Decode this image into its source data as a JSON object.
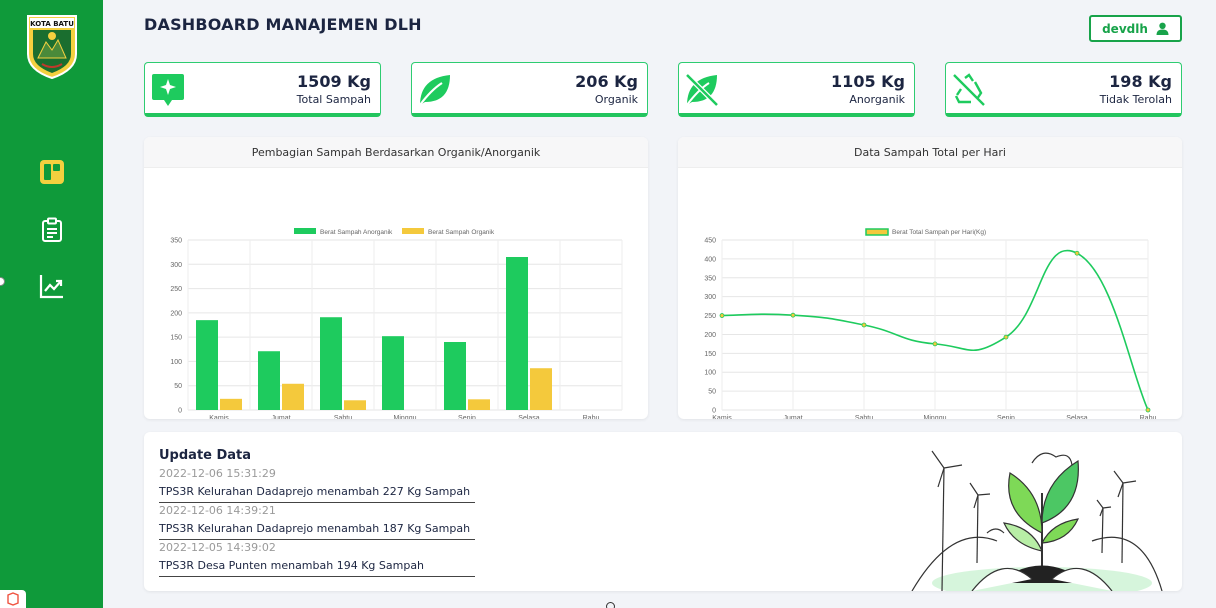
{
  "sidebar": {
    "logo_text": "KOTA BATU",
    "items": [
      {
        "icon": "dashboard-icon"
      },
      {
        "icon": "clipboard-icon"
      },
      {
        "icon": "chart-icon"
      }
    ]
  },
  "header": {
    "title": "DASHBOARD MANAJEMEN DLH",
    "user": "devdlh"
  },
  "stats": [
    {
      "value": "1509 Kg",
      "label": "Total Sampah",
      "icon": "sparkle-pin-icon"
    },
    {
      "value": "206 Kg",
      "label": "Organik",
      "icon": "leaf-icon"
    },
    {
      "value": "1105 Kg",
      "label": "Anorganik",
      "icon": "leaf-off-icon"
    },
    {
      "value": "198 Kg",
      "label": "Tidak Terolah",
      "icon": "recycle-off-icon"
    }
  ],
  "charts_titles": {
    "bar": "Pembagian Sampah Berdasarkan Organik/Anorganik",
    "line": "Data Sampah Total per Hari"
  },
  "chart_data": [
    {
      "type": "bar",
      "categories": [
        "Kamis",
        "Jumat",
        "Sabtu",
        "Minggu",
        "Senin",
        "Selasa",
        "Rabu"
      ],
      "series": [
        {
          "name": "Berat Sampah Anorganik",
          "values": [
            185,
            121,
            191,
            152,
            140,
            315,
            0
          ]
        },
        {
          "name": "Berat Sampah Organik",
          "values": [
            23,
            54,
            20,
            0,
            22,
            86,
            0
          ]
        }
      ],
      "ylim": [
        0,
        350
      ],
      "yticks": [
        0,
        50,
        100,
        150,
        200,
        250,
        300,
        350
      ],
      "grid": true,
      "legend": "top",
      "colors": [
        "#1ecb5e",
        "#f4c93c"
      ]
    },
    {
      "type": "line",
      "categories": [
        "Kamis",
        "Jumat",
        "Sabtu",
        "Minggu",
        "Senin",
        "Selasa",
        "Rabu"
      ],
      "series": [
        {
          "name": "Berat Total Sampah per Hari(Kg)",
          "values": [
            250,
            251,
            225,
            175,
            193,
            415,
            0
          ]
        }
      ],
      "ylim": [
        0,
        450
      ],
      "yticks": [
        0,
        50,
        100,
        150,
        200,
        250,
        300,
        350,
        400,
        450
      ],
      "grid": true,
      "legend": "top",
      "colors": [
        "#1ecb5e",
        "#f4c93c"
      ]
    }
  ],
  "updates": {
    "title": "Update Data",
    "items": [
      {
        "time": "2022-12-06 15:31:29",
        "text": "TPS3R Kelurahan Dadaprejo menambah 227 Kg Sampah"
      },
      {
        "time": "2022-12-06 14:39:21",
        "text": "TPS3R Kelurahan Dadaprejo menambah 187 Kg Sampah"
      },
      {
        "time": "2022-12-05 14:39:02",
        "text": "TPS3R Desa Punten menambah 194 Kg Sampah"
      }
    ]
  }
}
